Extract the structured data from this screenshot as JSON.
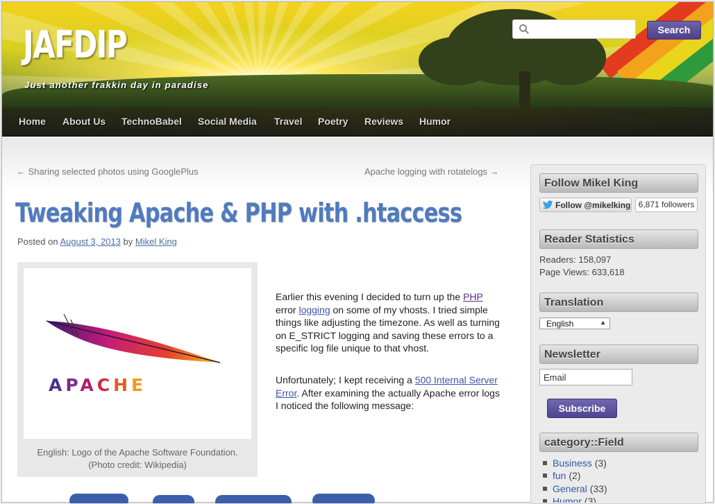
{
  "header": {
    "site_title": "JAFDIP",
    "tagline": "Just another frakkin day in paradise",
    "search_placeholder": "",
    "search_button": "Search"
  },
  "nav": {
    "items": [
      {
        "label": "Home"
      },
      {
        "label": "About Us"
      },
      {
        "label": "TechnoBabel"
      },
      {
        "label": "Social Media"
      },
      {
        "label": "Travel"
      },
      {
        "label": "Poetry"
      },
      {
        "label": "Reviews"
      },
      {
        "label": "Humor"
      }
    ]
  },
  "post_nav": {
    "previous": "← Sharing selected photos using GooglePlus",
    "next": "Apache logging with rotatelogs →"
  },
  "post": {
    "title": "Tweaking Apache & PHP with .htaccess",
    "posted_on": "Posted on",
    "date": "August 3, 2013",
    "by": "by",
    "author": "Mikel King",
    "figure": {
      "logo_text": "APACHE",
      "caption_line1": "English: Logo of the Apache Software Foundation.",
      "caption_line2": "(Photo credit: Wikipedia)"
    },
    "para1": {
      "t1": "Earlier this evening I decided to turn up the ",
      "link1": "PHP",
      "t2": " error ",
      "link2": "logging",
      "t3": " on some of my vhosts. I tried simple things like adjusting the timezone. As well as turning on E_STRICT logging and saving these errors to a specific log file unique to that vhost."
    },
    "para2": {
      "t1": "Unfortunately; I kept receiving a ",
      "link1": "500 Internal Server Error",
      "t2": ". After examining the actually Apache error logs I noticed the following message:"
    }
  },
  "sidebar": {
    "follow": {
      "title": "Follow Mikel King",
      "button": "Follow @mikelking",
      "count": "6,871 followers"
    },
    "stats": {
      "title": "Reader Statistics",
      "readers": "Readers: 158,097",
      "page_views": "Page Views: 633,618"
    },
    "translation": {
      "title": "Translation",
      "selected": "English"
    },
    "newsletter": {
      "title": "Newsletter",
      "email_placeholder": "Email",
      "subscribe": "Subscribe"
    },
    "categories": {
      "title": "category::Field",
      "items": [
        {
          "name": "Business",
          "count": "(3)"
        },
        {
          "name": "fun",
          "count": "(2)"
        },
        {
          "name": "General",
          "count": "(33)"
        },
        {
          "name": "Humor",
          "count": "(3)"
        }
      ]
    }
  },
  "colors": {
    "accent": "#4f7bbf",
    "button": "#5a4f9a",
    "link": "#3d54a8"
  }
}
